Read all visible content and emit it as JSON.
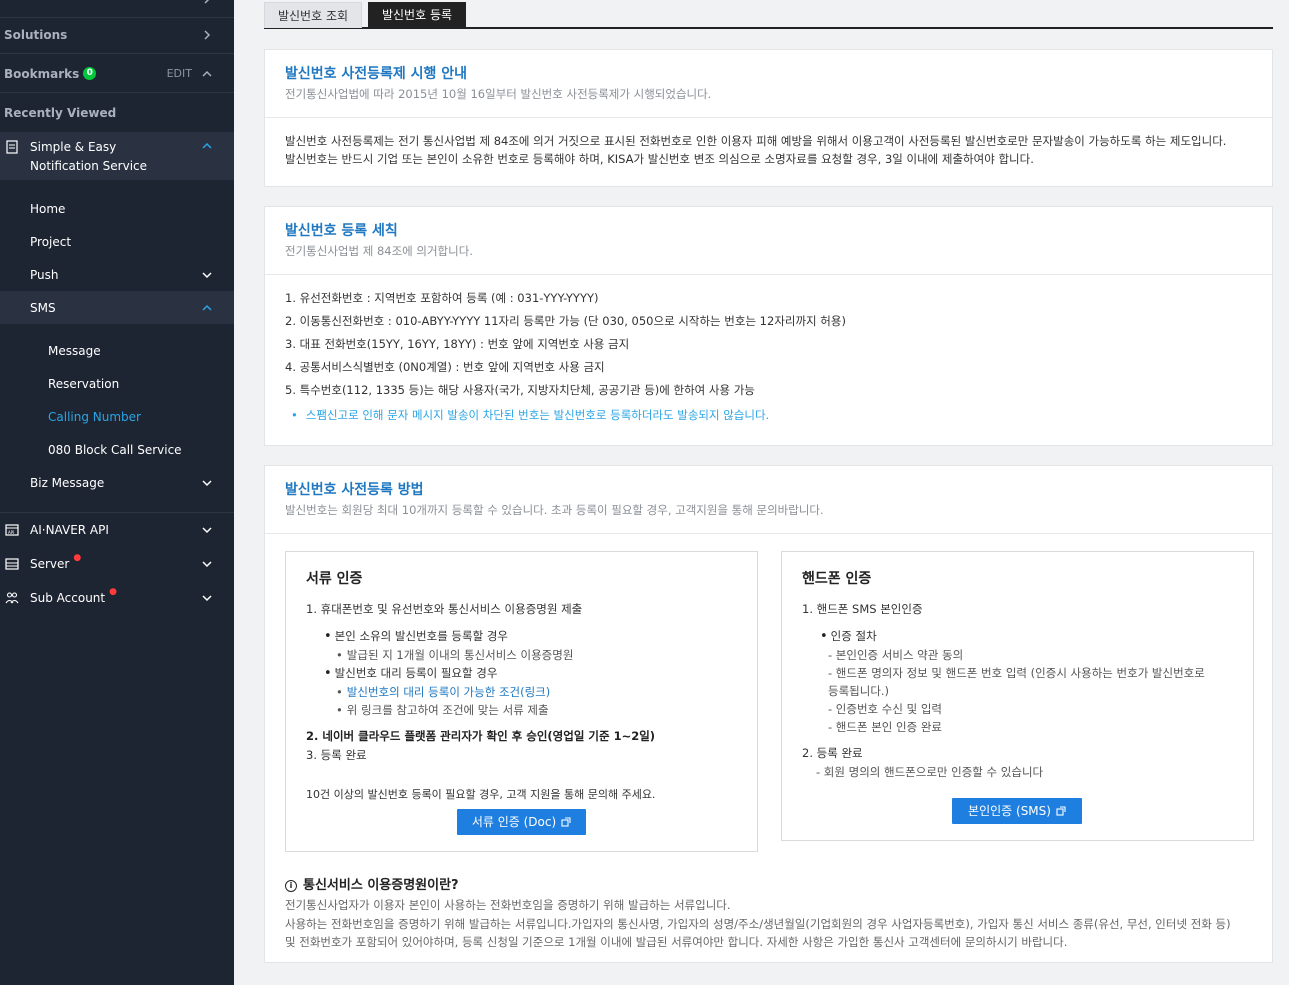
{
  "sidebar": {
    "solutions_label": "Solutions",
    "bookmarks_label": "Bookmarks",
    "bookmarks_count": "0",
    "edit_label": "EDIT",
    "recently_viewed_label": "Recently Viewed",
    "service_title": "Simple & Easy Notification Service",
    "nav": {
      "home": "Home",
      "project": "Project",
      "push": "Push",
      "sms": "SMS",
      "message": "Message",
      "reservation": "Reservation",
      "calling_number": "Calling Number",
      "block_call": "080 Block Call Service",
      "biz_message": "Biz Message"
    },
    "products": {
      "ai_naver_api": "AI·NAVER API",
      "server": "Server",
      "sub_account": "Sub Account"
    },
    "accent_color": "#2aa4e6",
    "alert_color": "#ff3b3b"
  },
  "tabs": {
    "lookup": "발신번호 조회",
    "register": "발신번호 등록"
  },
  "notice_card": {
    "title": "발신번호 사전등록제 시행 안내",
    "subtitle": "전기통신사업법에 따라 2015년 10월 16일부터 발신번호 사전등록제가 시행되었습니다.",
    "line1": "발신번호 사전등록제는 전기 통신사업법 제 84조에 의거 거짓으로 표시된 전화번호로 인한 이용자 피해 예방을 위해서 이용고객이 사전등록된 발신번호로만 문자발송이 가능하도록 하는 제도입니다.",
    "line2": "발신번호는 반드시 기업 또는 본인이 소유한 번호로 등록해야 하며, KISA가 발신번호 변조 의심으로 소명자료를 요청할 경우, 3일 이내에 제출하여야 합니다."
  },
  "rules_card": {
    "title": "발신번호 등록 세칙",
    "subtitle": "전기통신사업법 제 84조에 의거합니다.",
    "rules": [
      "1. 유선전화번호 : 지역번호 포함하여 등록 (예 : 031-YYY-YYYY)",
      "2. 이동통신전화번호 : 010-ABYY-YYYY 11자리 등록만 가능 (단 030, 050으로 시작하는 번호는 12자리까지 허용)",
      "3. 대표 전화번호(15YY, 16YY, 18YY) : 번호 앞에 지역번호 사용 금지",
      "4. 공통서비스식별번호 (0N0계열) : 번호 앞에 지역번호 사용 금지",
      "5. 특수번호(112, 1335 등)는 해당 사용자(국가, 지방자치단체, 공공기관 등)에 한하여 사용 가능"
    ],
    "notice": "스팸신고로 인해 문자 메시지 발송이 차단된 번호는 발신번호로 등록하더라도 발송되지 않습니다."
  },
  "method_card": {
    "title": "발신번호 사전등록 방법",
    "subtitle": "발신번호는 회원당 최대 10개까지 등록할 수 있습니다. 초과 등록이 필요할 경우, 고객지원을 통해 문의바랍니다.",
    "doc": {
      "title": "서류 인증",
      "step1": "1. 휴대폰번호 및 유선번호와 통신서비스 이용증명원 제출",
      "own_case": "본인 소유의 발신번호를 등록할 경우",
      "own_detail": "발급된 지 1개월 이내의 통신서비스 이용증명원",
      "proxy_case": "발신번호 대리 등록이 필요할 경우",
      "proxy_link": "발신번호의 대리 등록이 가능한 조건(링크)",
      "proxy_detail": "위 링크를 참고하여 조건에 맞는 서류 제출",
      "step2": "2. 네이버 클라우드 플랫폼 관리자가 확인 후 승인(영업일 기준 1~2일)",
      "step3": "3. 등록 완료",
      "note": "10건 이상의 발신번호 등록이 필요할 경우, 고객 지원을 통해 문의해 주세요.",
      "button": "서류 인증 (Doc)"
    },
    "phone": {
      "title": "핸드폰 인증",
      "step1": "1. 핸드폰 SMS 본인인증",
      "procedure": "인증 절차",
      "p1": "- 본인인증 서비스 약관 동의",
      "p2a": "- 핸드폰 명의자 정보 및 핸드폰 번호 입력 (인증시 사용하는 번호가 발신번호로",
      "p2b": "등록됩니다.)",
      "p3": "- 인증번호 수신 및 입력",
      "p4": "- 핸드폰 본인 인증 완료",
      "step2": "2. 등록 완료",
      "step2_detail": "- 회원 명의의 핸드폰으로만 인증할 수 있습니다",
      "button": "본인인증 (SMS)"
    },
    "info": {
      "title": "통신서비스 이용증명원이란?",
      "line1": "전기통신사업자가 이용자 본인이 사용하는 전화번호임을 증명하기 위해 발급하는 서류입니다.",
      "line2": "사용하는 전화번호임을 증명하기 위해 발급하는 서류입니다.가입자의 통신사명, 가입자의 성명/주소/생년월일(기업회원의 경우 사업자등록번호), 가입자 통신 서비스 종류(유선, 무선, 인터넷 전화 등)",
      "line3": "및 전화번호가 포함되어 있어야하며, 등록 신청일 기준으로 1개월 이내에 발급된 서류여야만 합니다. 자세한 사항은 가입한 통신사 고객센터에 문의하시기 바랍니다."
    }
  }
}
